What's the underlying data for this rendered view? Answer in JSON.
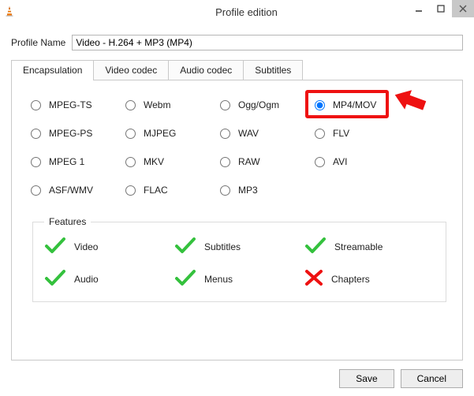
{
  "window": {
    "title": "Profile edition"
  },
  "profile": {
    "label": "Profile Name",
    "value": "Video - H.264 + MP3 (MP4)"
  },
  "tabs": [
    {
      "label": "Encapsulation"
    },
    {
      "label": "Video codec"
    },
    {
      "label": "Audio codec"
    },
    {
      "label": "Subtitles"
    }
  ],
  "encapsulation": {
    "options": [
      {
        "label": "MPEG-TS"
      },
      {
        "label": "Webm"
      },
      {
        "label": "Ogg/Ogm"
      },
      {
        "label": "MP4/MOV"
      },
      {
        "label": "MPEG-PS"
      },
      {
        "label": "MJPEG"
      },
      {
        "label": "WAV"
      },
      {
        "label": "FLV"
      },
      {
        "label": "MPEG 1"
      },
      {
        "label": "MKV"
      },
      {
        "label": "RAW"
      },
      {
        "label": "AVI"
      },
      {
        "label": "ASF/WMV"
      },
      {
        "label": "FLAC"
      },
      {
        "label": "MP3"
      }
    ],
    "selected": "MP4/MOV"
  },
  "features": {
    "legend": "Features",
    "items": [
      {
        "label": "Video",
        "supported": true
      },
      {
        "label": "Subtitles",
        "supported": true
      },
      {
        "label": "Streamable",
        "supported": true
      },
      {
        "label": "Audio",
        "supported": true
      },
      {
        "label": "Menus",
        "supported": true
      },
      {
        "label": "Chapters",
        "supported": false
      }
    ]
  },
  "buttons": {
    "save": "Save",
    "cancel": "Cancel"
  },
  "annotation": {
    "highlight_target": "MP4/MOV",
    "highlight_color": "#e11"
  }
}
